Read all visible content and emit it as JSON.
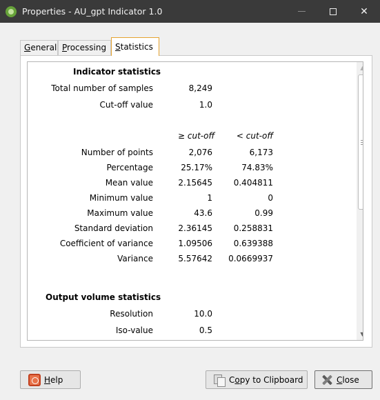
{
  "window": {
    "title": "Properties - AU_gpt Indicator 1.0",
    "icon": "app-logo-icon",
    "controls": {
      "minimize": "minimize-icon",
      "maximize": "maximize-icon",
      "close": "✕"
    }
  },
  "tabs": [
    {
      "accel": "G",
      "rest": "eneral"
    },
    {
      "accel": "P",
      "rest": "rocessing"
    },
    {
      "accel": "S",
      "rest": "tatistics",
      "active": true
    }
  ],
  "stats": {
    "indicator_header": "Indicator statistics",
    "total_samples_label": "Total number of samples",
    "total_samples_value": "8,249",
    "cutoff_label": "Cut-off value",
    "cutoff_value": "1.0",
    "col_above": "≥ cut-off",
    "col_below": "< cut-off",
    "rows": [
      {
        "label": "Number of points",
        "above": "2,076",
        "below": "6,173"
      },
      {
        "label": "Percentage",
        "above": "25.17%",
        "below": "74.83%"
      },
      {
        "label": "Mean value",
        "above": "2.15645",
        "below": "0.404811"
      },
      {
        "label": "Minimum value",
        "above": "1",
        "below": "0"
      },
      {
        "label": "Maximum value",
        "above": "43.6",
        "below": "0.99"
      },
      {
        "label": "Standard deviation",
        "above": "2.36145",
        "below": "0.258831"
      },
      {
        "label": "Coefficient of variance",
        "above": "1.09506",
        "below": "0.639388"
      },
      {
        "label": "Variance",
        "above": "5.57642",
        "below": "0.0669937"
      }
    ],
    "output_header": "Output volume statistics",
    "resolution_label": "Resolution",
    "resolution_value": "10.0",
    "iso_label": "Iso-value",
    "iso_value": "0.5"
  },
  "buttons": {
    "help": {
      "accel": "H",
      "rest": "elp"
    },
    "copy": {
      "pre": "C",
      "accel": "o",
      "rest": "py to Clipboard"
    },
    "close": {
      "accel": "C",
      "rest": "lose"
    }
  },
  "colors": {
    "titlebar": "#3a3a3a",
    "active_tab_border": "#e5a22e"
  }
}
